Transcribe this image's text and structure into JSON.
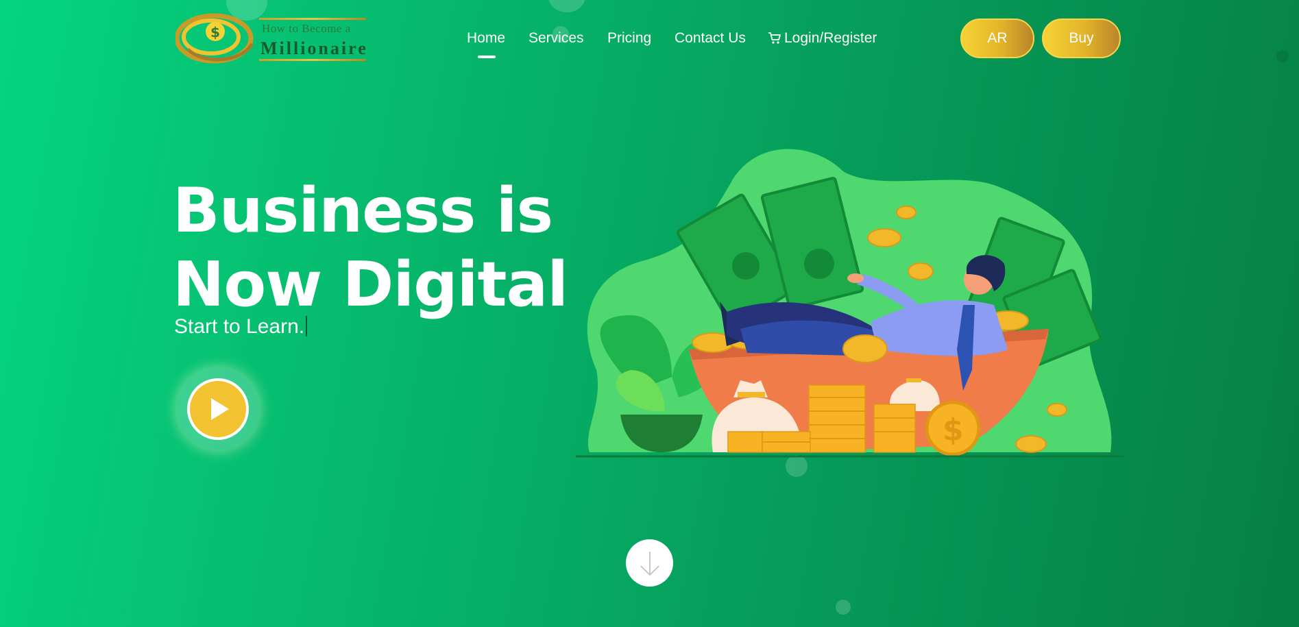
{
  "brand": {
    "logo_line1": "How to Become a",
    "logo_line2": "Millionaire"
  },
  "nav": {
    "items": [
      {
        "label": "Home",
        "active": true
      },
      {
        "label": "Services",
        "active": false
      },
      {
        "label": "Pricing",
        "active": false
      },
      {
        "label": "Contact Us",
        "active": false
      },
      {
        "label": "Login/Register",
        "active": false,
        "icon": "cart-icon"
      }
    ]
  },
  "actions": {
    "ar_label": "AR",
    "buy_label": "Buy"
  },
  "hero": {
    "title_line1": "Business is",
    "title_line2": "Now Digital",
    "subtitle": "Start to Learn."
  },
  "colors": {
    "bg_start": "#05d47e",
    "bg_end": "#067f43",
    "gold": "#f2c230",
    "illustration_blob": "#4fd86f"
  },
  "icons": {
    "play": "play-icon",
    "scroll": "arrow-down-icon"
  }
}
